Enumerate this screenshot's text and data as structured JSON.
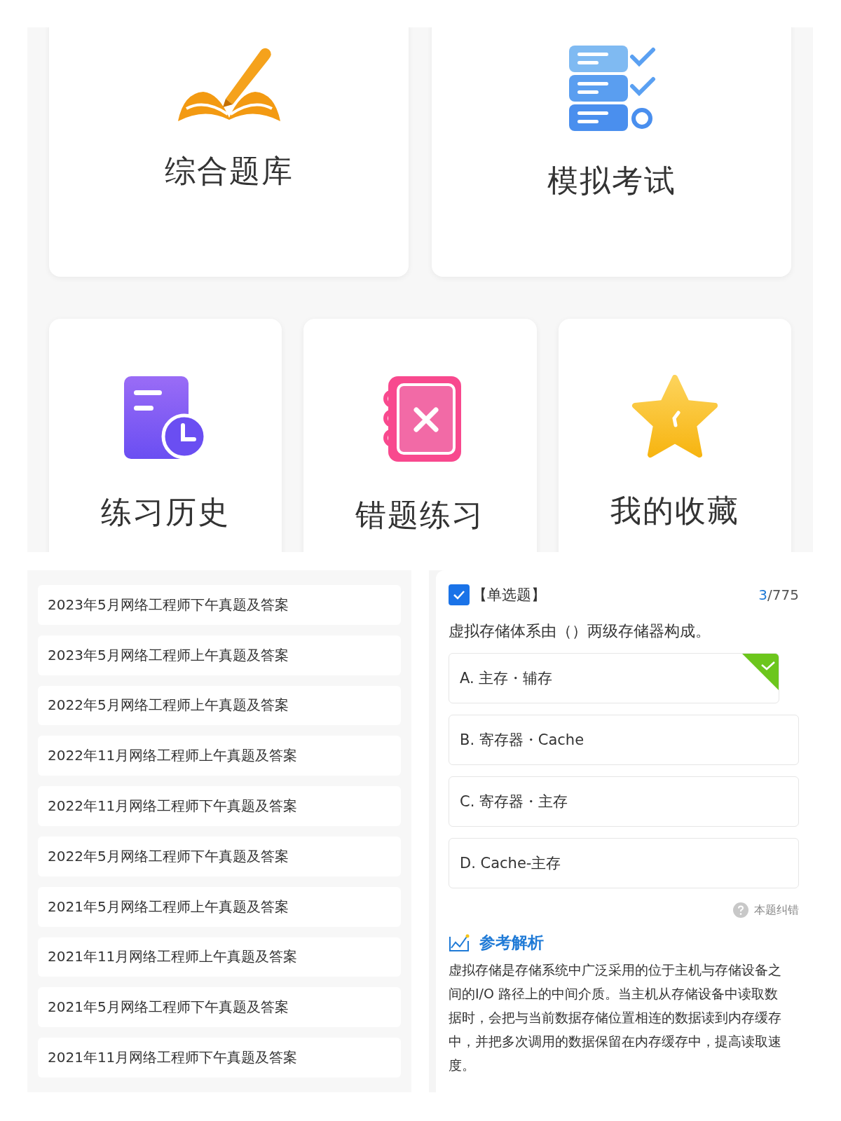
{
  "menu_cards": [
    {
      "kind": "book",
      "label": "综合题库"
    },
    {
      "kind": "exam",
      "label": "模拟考试"
    },
    {
      "kind": "history",
      "label": "练习历史"
    },
    {
      "kind": "mistakes",
      "label": "错题练习"
    },
    {
      "kind": "favorites",
      "label": "我的收藏"
    }
  ],
  "exam_list": [
    "2023年5月网络工程师下午真题及答案",
    "2023年5月网络工程师上午真题及答案",
    "2022年5月网络工程师上午真题及答案",
    "2022年11月网络工程师上午真题及答案",
    "2022年11月网络工程师下午真题及答案",
    "2022年5月网络工程师下午真题及答案",
    "2021年5月网络工程师上午真题及答案",
    "2021年11月网络工程师上午真题及答案",
    "2021年5月网络工程师下午真题及答案",
    "2021年11月网络工程师下午真题及答案"
  ],
  "question": {
    "checked": true,
    "type": "【单选题】",
    "current": "3",
    "total": "/775",
    "text": "虚拟存储体系由（）两级存储器构成。",
    "options": [
      {
        "text": "A. 主存・辅存",
        "correct": true
      },
      {
        "text": "B. 寄存器・Cache",
        "correct": false
      },
      {
        "text": "C. 寄存器・主存",
        "correct": false
      },
      {
        "text": "D. Cache-主存",
        "correct": false
      }
    ],
    "report": "本题纠错",
    "analysis_title": "参考解析",
    "analysis": "虚拟存储是存储系统中广泛采用的位于主机与存储设备之间的I/O 路径上的中间介质。当主机从存储设备中读取数据时，会把与当前数据存储位置相连的数据读到内存缓存中，并把多次调用的数据保留在内存缓存中，提高读取速度。"
  }
}
